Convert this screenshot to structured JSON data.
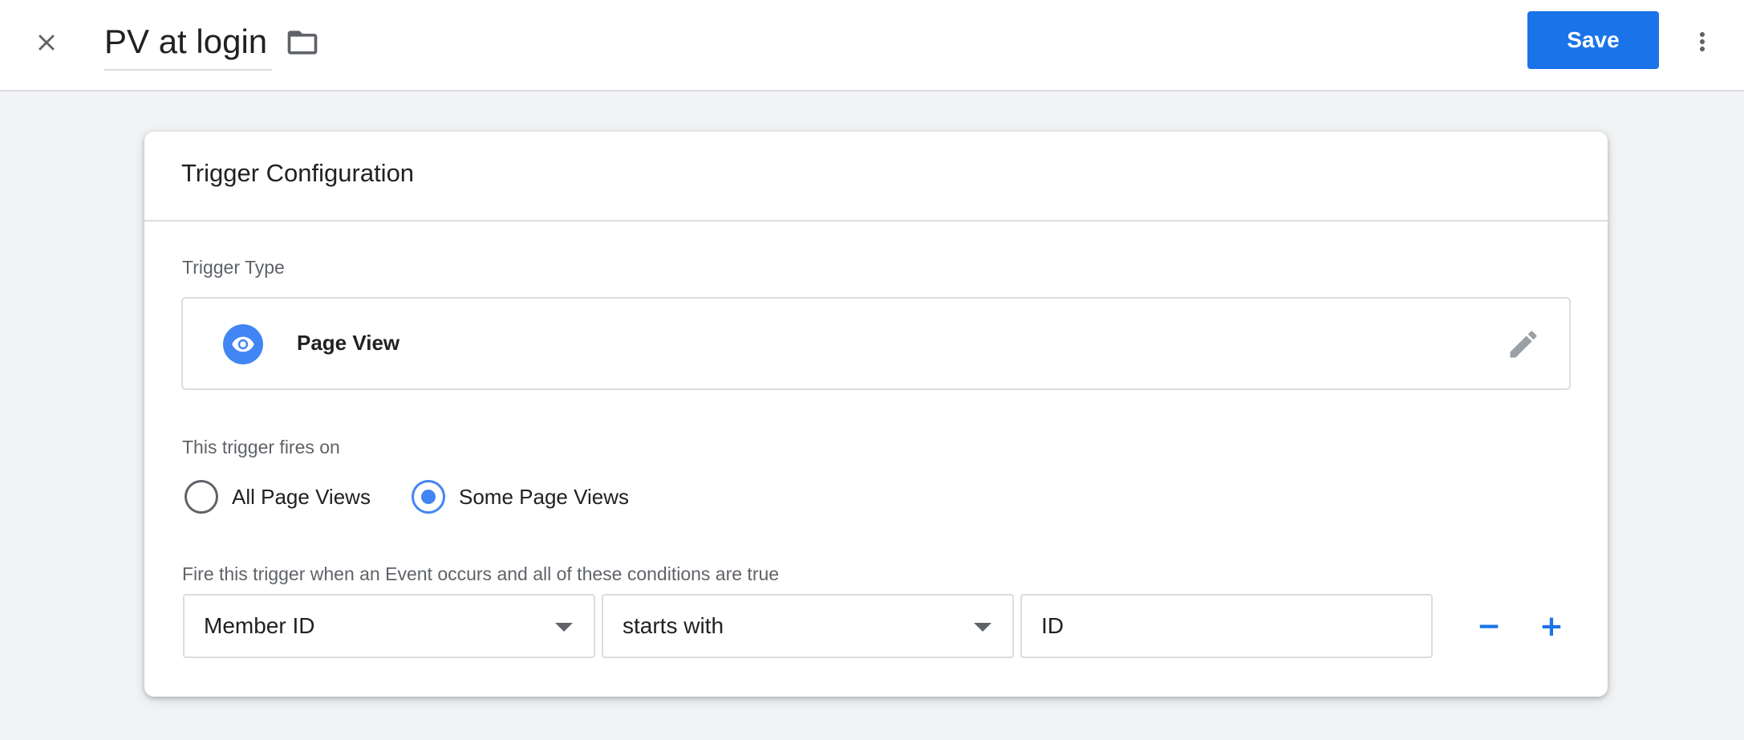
{
  "header": {
    "title": "PV at login",
    "save_label": "Save",
    "icons": {
      "close": "close-icon",
      "folder": "folder-icon",
      "more": "more-vert-icon"
    }
  },
  "card": {
    "title": "Trigger Configuration",
    "trigger_type_label": "Trigger Type",
    "trigger_type": {
      "name": "Page View",
      "icon": "eye-icon",
      "edit_icon": "pencil-icon"
    },
    "fires_on_label": "This trigger fires on",
    "fires_on_options": [
      {
        "label": "All Page Views",
        "checked": false
      },
      {
        "label": "Some Page Views",
        "checked": true
      }
    ],
    "condition_label": "Fire this trigger when an Event occurs and all of these conditions are true",
    "condition": {
      "variable": "Member ID",
      "operator": "starts with",
      "value": "ID"
    },
    "remove_label": "−",
    "add_label": "+"
  },
  "colors": {
    "accent": "#1a73e8",
    "icon_blue": "#4285f4",
    "background": "#f1f3f4",
    "border": "#dadce0",
    "muted_text": "#5f6368"
  }
}
